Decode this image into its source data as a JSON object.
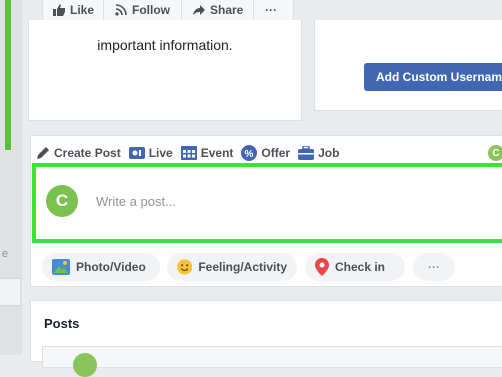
{
  "page_actions": {
    "like": "Like",
    "follow": "Follow",
    "share": "Share",
    "more": "···"
  },
  "about": {
    "text": "important information."
  },
  "username": {
    "button": "Add Custom Username"
  },
  "composer": {
    "tabs": [
      "Create Post",
      "Live",
      "Event",
      "Offer",
      "Job"
    ],
    "avatar_letter": "C",
    "placeholder": "Write a post...",
    "side_avatar_letter": "C"
  },
  "actions": {
    "photo": "Photo/Video",
    "feeling": "Feeling/Activity",
    "checkin": "Check in",
    "more": "···"
  },
  "posts": {
    "title": "Posts"
  },
  "left_fragment": "e",
  "colors": {
    "accent_green": "#3de23b",
    "brand_blue": "#4267b2",
    "avatar_green": "#7bc14e"
  }
}
